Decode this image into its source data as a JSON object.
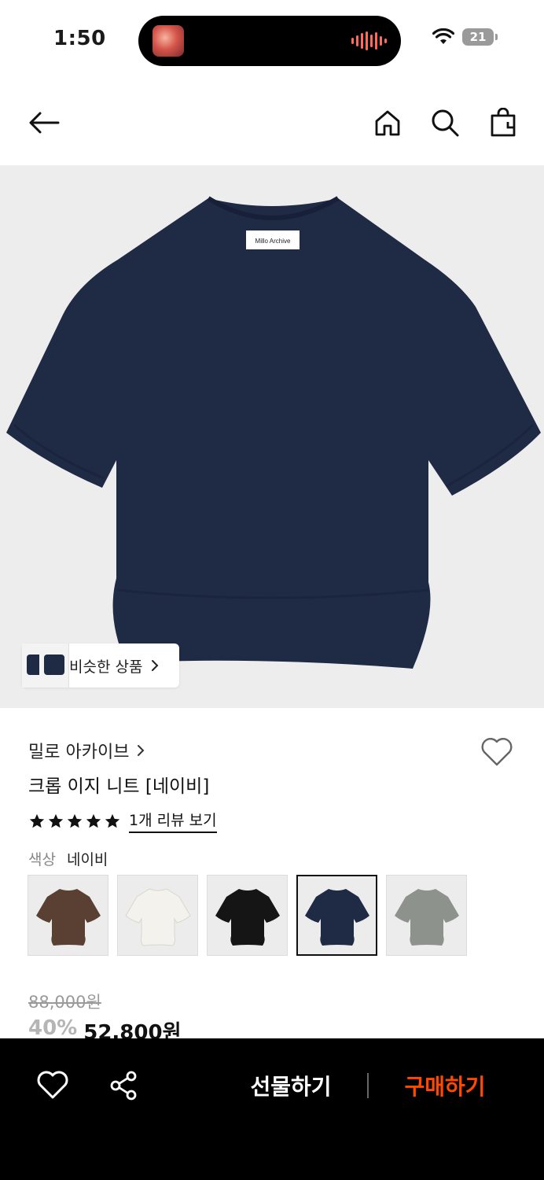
{
  "status_bar": {
    "time": "1:50",
    "battery": "21"
  },
  "nav": {
    "icons": [
      "back-arrow-icon",
      "home-icon",
      "search-icon",
      "shopping-bag-icon"
    ]
  },
  "hero": {
    "product_label": "Millo Archive",
    "similar_chip": "비슷한 상품"
  },
  "product": {
    "brand": "밀로 아카이브",
    "name": "크롭 이지 니트 [네이비]",
    "rating_stars": 5,
    "review_link": "1개 리뷰 보기",
    "color_label": "색상",
    "color_value": "네이비",
    "swatch_colors": [
      "#5a4032",
      "#f4f2ec",
      "#151515",
      "#1f2a45",
      "#8e928c"
    ],
    "selected_swatch": 3,
    "original_price": "88,000원",
    "discount": "40%",
    "sale_price": "52,800원"
  },
  "bottom_bar": {
    "gift_label": "선물하기",
    "buy_label": "구매하기",
    "buy_color": "#ff4800"
  }
}
